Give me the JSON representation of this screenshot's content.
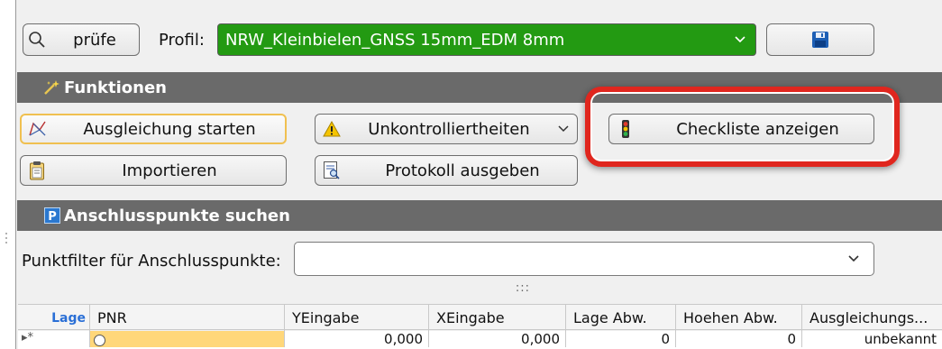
{
  "toolbar": {
    "check_label": "prüfe",
    "profile_label": "Profil:",
    "profile_value": "NRW_Kleinbielen_GNSS 15mm_EDM 8mm",
    "profile_bg": "#239a12"
  },
  "functions": {
    "title": "Funktionen",
    "adjust_label": "Ausgleichung starten",
    "uncontrolled_label": "Unkontrolliertheiten",
    "checklist_label": "Checkliste anzeigen",
    "import_label": "Importieren",
    "protocol_label": "Protokoll ausgeben"
  },
  "anchor_points": {
    "title": "Anschlusspunkte suchen",
    "filter_label": "Punktfilter für Anschlusspunkte:",
    "filter_value": ""
  },
  "splitter": ":::",
  "table": {
    "group_label": "Lage",
    "columns": [
      "PNR",
      "YEingabe",
      "XEingabe",
      "Lage Abw.",
      "Hoehen Abw.",
      "Ausgleichungs..."
    ],
    "row": {
      "marker": "▸*",
      "pnr": "",
      "y": "0,000",
      "x": "0,000",
      "lage_abw": "0",
      "hoehen_abw": "0",
      "status": "unbekannt"
    }
  },
  "colors": {
    "accent_highlight": "#e0261e",
    "section_bg": "#6a6a6a",
    "selected_cell": "#ffd77a"
  }
}
